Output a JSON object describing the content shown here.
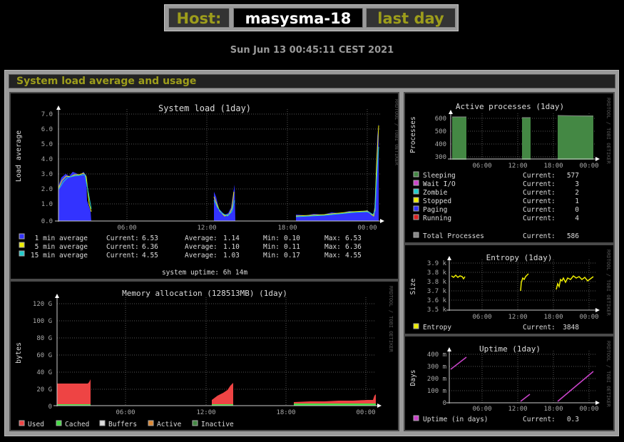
{
  "header": {
    "host_label": "Host:",
    "host_name": "masysma-18",
    "period": "last day"
  },
  "date": "Sun Jun 13 00:45:11 CEST 2021",
  "section_title": "System load average and usage",
  "watermark": "RRDTOOL / TOBI OETIKER",
  "x_ticks": [
    "06:00",
    "12:00",
    "18:00",
    "00:00"
  ],
  "graphs": {
    "load": {
      "title": "System load  (1day)",
      "ylabel": "Load average",
      "y_ticks": [
        "7.0",
        "6.0",
        "5.0",
        "4.0",
        "3.0",
        "2.0",
        "1.0",
        "0.0"
      ],
      "legend": [
        {
          "label": "1 min average",
          "color": "#3333ff",
          "current": "6.53",
          "average": "1.14",
          "min": "0.10",
          "max": "6.53"
        },
        {
          "label": "5 min average",
          "color": "#eeee00",
          "current": "6.36",
          "average": "1.10",
          "min": "0.11",
          "max": "6.36"
        },
        {
          "label": "15 min average",
          "color": "#22cccc",
          "current": "4.55",
          "average": "1.03",
          "min": "0.17",
          "max": "4.55"
        }
      ],
      "stat_labels": {
        "current": "Current:",
        "average": "Average:",
        "min": "Min:",
        "max": "Max:"
      },
      "footer": "system uptime:  6h 14m"
    },
    "memory": {
      "title": "Memory allocation (128513MB)  (1day)",
      "ylabel": "bytes",
      "y_ticks": [
        "120 G",
        "100 G",
        "80 G",
        "60 G",
        "40 G",
        "20 G",
        "0"
      ],
      "legend": [
        {
          "label": "Used",
          "color": "#ee4444"
        },
        {
          "label": "Cached",
          "color": "#44dd44"
        },
        {
          "label": "Buffers",
          "color": "#dddddd"
        },
        {
          "label": "Active",
          "color": "#dd8833"
        },
        {
          "label": "Inactive",
          "color": "#448844"
        }
      ]
    },
    "processes": {
      "title": "Active processes  (1day)",
      "ylabel": "Processes",
      "y_ticks": [
        "600",
        "500",
        "400",
        "300",
        "200",
        "100",
        "0"
      ],
      "legend": [
        {
          "label": "Sleeping",
          "color": "#448844",
          "current": "577"
        },
        {
          "label": "Wait I/O",
          "color": "#cc44cc",
          "current": "3"
        },
        {
          "label": "Zombie",
          "color": "#22cccc",
          "current": "2"
        },
        {
          "label": "Stopped",
          "color": "#eeee00",
          "current": "1"
        },
        {
          "label": "Paging",
          "color": "#3333ff",
          "current": "0"
        },
        {
          "label": "Running",
          "color": "#dd2222",
          "current": "4"
        }
      ],
      "total": {
        "label": "Total Processes",
        "color": "#888888",
        "current": "586"
      },
      "current_label": "Current:"
    },
    "entropy": {
      "title": "Entropy  (1day)",
      "ylabel": "Size",
      "y_ticks": [
        "3.9 k",
        "3.8 k",
        "3.8 k",
        "3.7 k",
        "3.6 k",
        "3.5 k"
      ],
      "legend": {
        "label": "Entropy",
        "color": "#eeee00",
        "current": "3848"
      },
      "current_label": "Current:"
    },
    "uptime": {
      "title": "Uptime  (1day)",
      "ylabel": "Days",
      "y_ticks": [
        "400 m",
        "300 m",
        "200 m",
        "100 m",
        "0"
      ],
      "legend": {
        "label": "Uptime  (in days)",
        "color": "#cc44cc",
        "current": "0.3"
      },
      "current_label": "Current:"
    }
  }
}
